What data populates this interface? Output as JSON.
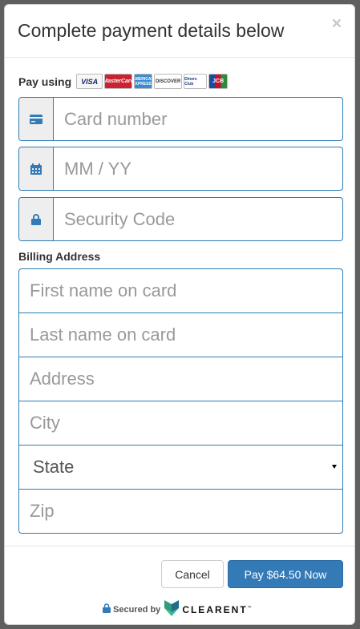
{
  "modal": {
    "title": "Complete payment details below",
    "close": "×"
  },
  "pay_using": {
    "label": "Pay using",
    "cards": [
      {
        "name": "visa",
        "text": "VISA"
      },
      {
        "name": "mastercard",
        "text": "MasterCard"
      },
      {
        "name": "amex",
        "text": "AMERICAN EXPRESS"
      },
      {
        "name": "discover",
        "text": "DISCOVER"
      },
      {
        "name": "diners",
        "text": "Diners Club"
      },
      {
        "name": "jcb",
        "text": "JCB"
      }
    ]
  },
  "card_fields": {
    "card_number": {
      "placeholder": "Card number",
      "icon": "credit-card-icon"
    },
    "expiry": {
      "placeholder": "MM / YY",
      "icon": "calendar-icon"
    },
    "security": {
      "placeholder": "Security Code",
      "icon": "lock-icon"
    }
  },
  "billing": {
    "label": "Billing Address",
    "first_name": "First name on card",
    "last_name": "Last name on card",
    "address": "Address",
    "city": "City",
    "state": "State",
    "zip": "Zip"
  },
  "footer": {
    "cancel": "Cancel",
    "pay": "Pay $64.50 Now",
    "secured_by": "Secured by",
    "brand": "CLEARENT",
    "brand_tm": "™"
  },
  "colors": {
    "primary": "#337ab7",
    "field_border": "#2a7cb6",
    "icon": "#337ab7"
  }
}
